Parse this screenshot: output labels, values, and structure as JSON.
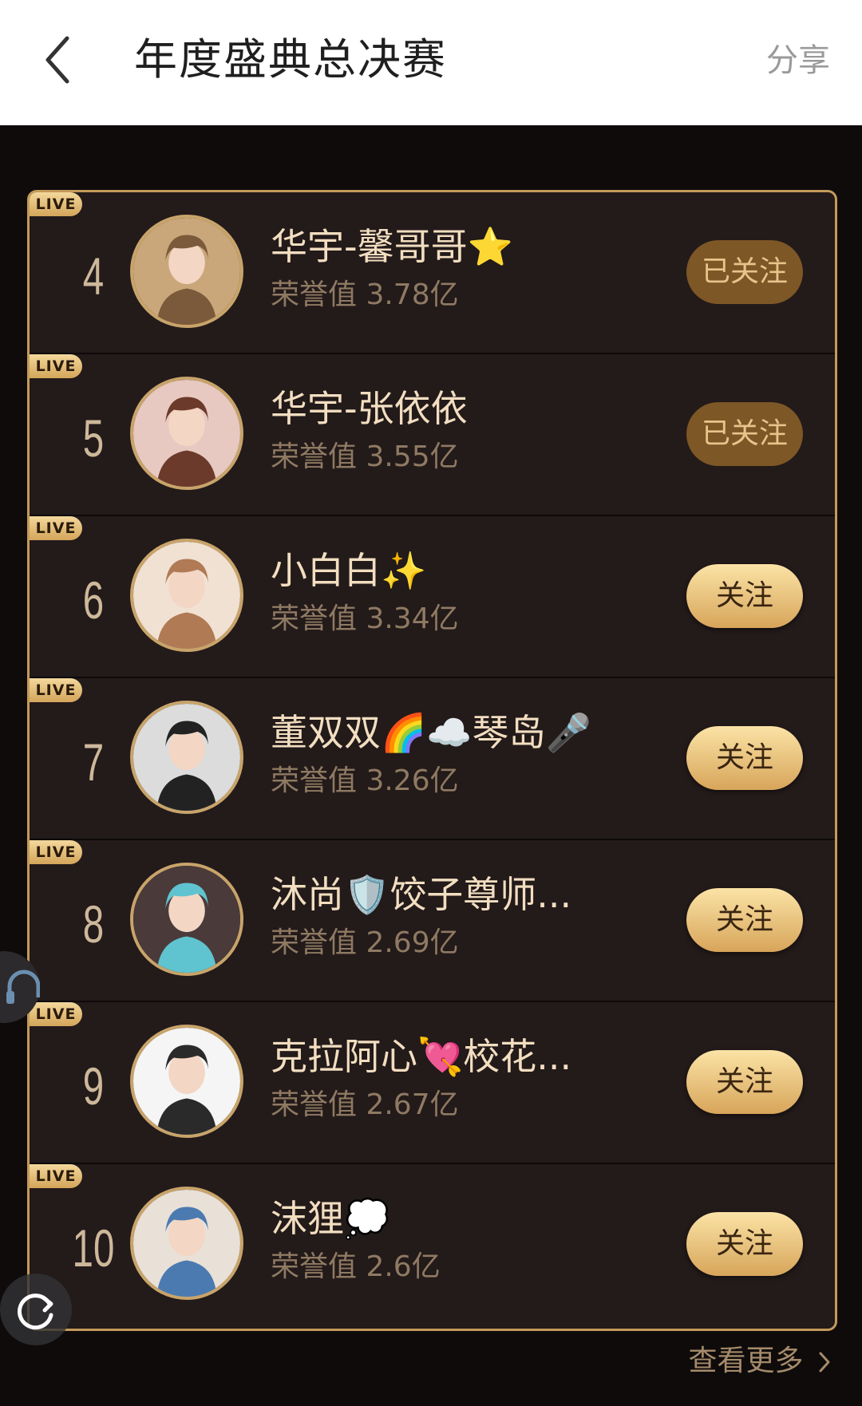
{
  "header": {
    "title": "年度盛典总决赛",
    "share_label": "分享",
    "back_icon": "chevron-left-icon"
  },
  "colors": {
    "gold": "#c49a5a",
    "board_bg": "#231a1a",
    "followed_btn": "#7d5726",
    "follow_btn": "#e7be74"
  },
  "ranking": [
    {
      "rank": "4",
      "live": "LIVE",
      "name": "华宇-馨哥哥⭐",
      "honor": "荣誉值 3.78亿",
      "button": "已关注",
      "followed": true
    },
    {
      "rank": "5",
      "live": "LIVE",
      "name": "华宇-张依依",
      "honor": "荣誉值 3.55亿",
      "button": "已关注",
      "followed": true
    },
    {
      "rank": "6",
      "live": "LIVE",
      "name": "小白白✨",
      "honor": "荣誉值 3.34亿",
      "button": "关注",
      "followed": false
    },
    {
      "rank": "7",
      "live": "LIVE",
      "name": "董双双🌈☁️琴岛🎤",
      "honor": "荣誉值 3.26亿",
      "button": "关注",
      "followed": false
    },
    {
      "rank": "8",
      "live": "LIVE",
      "name": "沐尚🛡️饺子尊师...",
      "honor": "荣誉值 2.69亿",
      "button": "关注",
      "followed": false
    },
    {
      "rank": "9",
      "live": "LIVE",
      "name": "克拉阿心💘校花...",
      "honor": "荣誉值 2.67亿",
      "button": "关注",
      "followed": false
    },
    {
      "rank": "10",
      "live": "LIVE",
      "name": "沫狸💭",
      "honor": "荣誉值 2.6亿",
      "button": "关注",
      "followed": false
    }
  ],
  "footer": {
    "more_label": "查看更多",
    "more_icon": "chevron-right-icon"
  },
  "floating": {
    "headset_icon": "headset-icon",
    "refresh_icon": "refresh-icon"
  }
}
